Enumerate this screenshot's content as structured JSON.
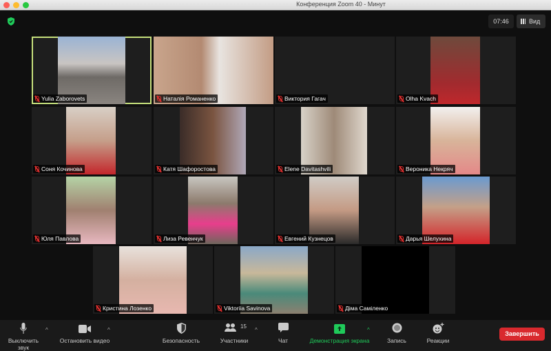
{
  "window": {
    "title": "Конференция Zoom   40 - Минут"
  },
  "header": {
    "timer": "07:46",
    "view_label": "Вид"
  },
  "participants": [
    {
      "name": "Yulia Zaborovets",
      "active": true,
      "bg": "#1e1e1e",
      "video": "linear-gradient(#9ab3d4 0%,#c9c5c2 40%,#6e6a66 60%,#8a8580 100%)"
    },
    {
      "name": "Наталія Романенко",
      "bg": "#c79f86",
      "video": "linear-gradient(90deg,#c9a58c,#b38a72 40%,#e8e4e0 55%,#c39c84)"
    },
    {
      "name": "Виктория Гагач",
      "bg": "#1e1e1e",
      "video": ""
    },
    {
      "name": "Olha Kvach",
      "bg": "#1e1e1e",
      "video": "linear-gradient(#6e4a3c,#a22a2e 70%,#c0282c)"
    },
    {
      "name": "Соня Кочинова",
      "bg": "#1e1e1e",
      "video": "linear-gradient(#d8d0c6,#c59f8a 50%,#c3262b)"
    },
    {
      "name": "Катя Шафоростова",
      "bg": "#1e1e1e",
      "video": "linear-gradient(90deg,#3a2c28,#7a5440 50%,#b0a8b8)"
    },
    {
      "name": "Elene Davitashvili",
      "bg": "#1e1e1e",
      "video": "linear-gradient(90deg,#d8d2c8,#9e8a78 50%,#e0d8ce)"
    },
    {
      "name": "Вероника Некряч",
      "bg": "#1e1e1e",
      "video": "linear-gradient(#f2f0ee,#d8b49a 50%,#e48888)"
    },
    {
      "name": "Юля Павлова",
      "bg": "#1e1e1e",
      "video": "linear-gradient(#b5d3a6,#a08070 50%,#e8b8c0)"
    },
    {
      "name": "Лиза Ревенчук",
      "bg": "#1e1e1e",
      "video": "linear-gradient(#c8c6c0,#8c7a6c 40%,#e83e8c 70%,#6e665c)"
    },
    {
      "name": "Евгений Кузнецов",
      "bg": "#1e1e1e",
      "video": "linear-gradient(#d0ccc6,#c49a84 50%,#2a2a2a)"
    },
    {
      "name": "Дарья Шелухина",
      "bg": "#1e1e1e",
      "video": "linear-gradient(#6a9ad0,#c4a088 45%,#d4242a)"
    },
    {
      "name": "Кристина Лозенко",
      "bg": "#1e1e1e",
      "video": "linear-gradient(#e8e2dc,#d4b0a0 50%,#e8b8b0)"
    },
    {
      "name": "Viktoriia Savinova",
      "bg": "#1e1e1e",
      "video": "linear-gradient(#8aa8c8,#c8b89a 40%,#4a8a7a 70%,#8c8070)"
    },
    {
      "name": "Діма Саміленко",
      "bg": "#1e1e1e",
      "video": "#000"
    }
  ],
  "toolbar": {
    "mute_label": "Выключить звук",
    "video_label": "Остановить видео",
    "security_label": "Безопасность",
    "participants_label": "Участники",
    "participants_count": "15",
    "chat_label": "Чат",
    "share_label": "Демонстрация экрана",
    "record_label": "Запись",
    "reactions_label": "Реакции",
    "end_label": "Завершить"
  },
  "colors": {
    "accent_green": "#1fcb5a",
    "end_red": "#d9292e",
    "active_speaker": "#c6e07c"
  }
}
